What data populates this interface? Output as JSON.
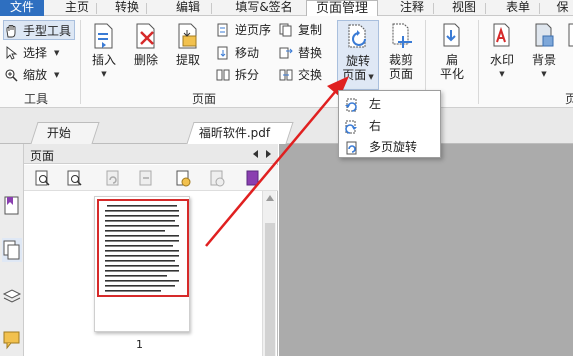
{
  "menu": {
    "tabs": [
      "文件",
      "主页",
      "转换",
      "编辑",
      "填写&签名",
      "页面管理",
      "注释",
      "视图",
      "表单",
      "保"
    ],
    "active": "页面管理"
  },
  "ribbon": {
    "tools_group": {
      "label": "工具",
      "items": [
        "手型工具",
        "选择",
        "缩放"
      ]
    },
    "pages_group": {
      "label": "页面",
      "big_buttons": [
        "插入",
        "删除",
        "提取"
      ],
      "small_buttons": [
        "逆页序",
        "移动",
        "拆分",
        "复制",
        "替换",
        "交换"
      ]
    },
    "rotate_button": {
      "line1": "旋转",
      "line2": "页面"
    },
    "crop_button": {
      "line1": "裁剪",
      "line2": "页面"
    },
    "flatten_button": {
      "line1": "扁",
      "line2": "平化"
    },
    "watermark_label": "水印",
    "background_label": "背景",
    "partial_label": "页"
  },
  "doc_tabs": [
    "开始",
    "福昕软件.pdf"
  ],
  "pages_panel": {
    "title": "页面",
    "thumbnail_page_number": "1"
  },
  "rotate_menu": {
    "items": [
      "左",
      "右",
      "多页旋转"
    ]
  },
  "colors": {
    "file_tab": "#2e6fc0",
    "annotation_red": "#e02020",
    "doc_background": "#ababab"
  }
}
